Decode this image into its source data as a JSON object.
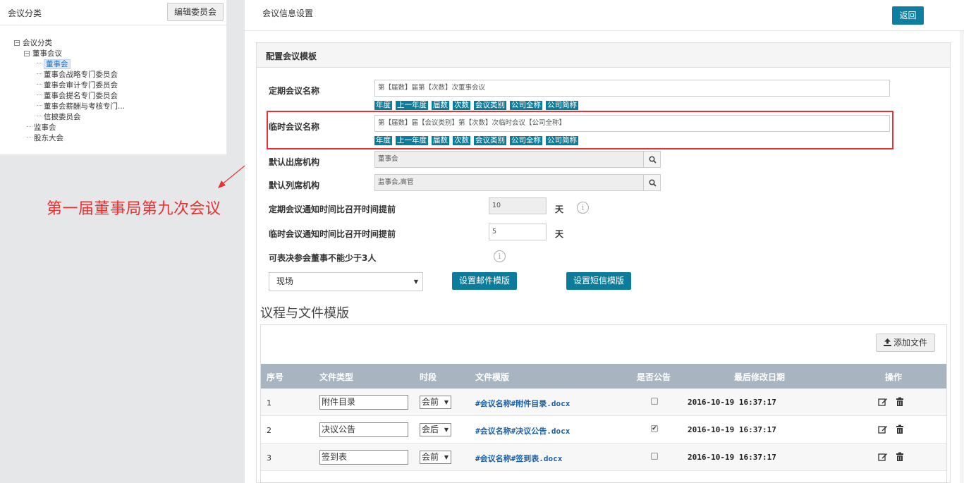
{
  "sidebar": {
    "title": "会议分类",
    "edit_button": "编辑委员会",
    "tree": {
      "root": "会议分类",
      "board": "董事会议",
      "board_children": [
        "董事会",
        "董事会战略专门委员会",
        "董事会审计专门委员会",
        "董事会提名专门委员会",
        "董事会薪酬与考核专门...",
        "信披委员会"
      ],
      "others": [
        "监事会",
        "股东大会"
      ]
    }
  },
  "annotation": {
    "text": "第一届董事局第九次会议",
    "color": "#e63232"
  },
  "header": {
    "title": "会议信息设置",
    "back_button": "返回"
  },
  "config": {
    "panel_title": "配置会议模板",
    "regular_name_label": "定期会议名称",
    "regular_name_value": "第【届数】届第【次数】次董事会议",
    "tags": [
      "年度",
      "上一年度",
      "届数",
      "次数",
      "会议类别",
      "公司全称",
      "公司简称"
    ],
    "temp_name_label": "临时会议名称",
    "temp_name_value": "第【届数】届【会议类别】第【次数】次临时会议【公司全称】",
    "attend_org_label": "默认出席机构",
    "attend_org_value": "董事会",
    "observer_org_label": "默认列席机构",
    "observer_org_value": "监事会,高管",
    "regular_notice_label": "定期会议通知时间比召开时间提前",
    "regular_notice_value": "10",
    "temp_notice_label": "临时会议通知时间比召开时间提前",
    "temp_notice_value": "5",
    "day_unit": "天",
    "quorum_label": "可表决参会董事不能少于3人",
    "mode_select": "现场",
    "email_template_button": "设置邮件模版",
    "sms_template_button": "设置短信模版"
  },
  "agenda": {
    "section_title": "议程与文件模版",
    "add_file_button": "添加文件",
    "columns": [
      "序号",
      "文件类型",
      "时段",
      "文件模版",
      "是否公告",
      "最后修改日期",
      "操作"
    ],
    "rows": [
      {
        "no": "1",
        "type": "附件目录",
        "period": "会前",
        "template": "#会议名称#附件目录.docx",
        "announce": false,
        "date": "2016-10-19 16:37:17"
      },
      {
        "no": "2",
        "type": "决议公告",
        "period": "会后",
        "template": "#会议名称#决议公告.docx",
        "announce": true,
        "date": "2016-10-19 16:37:17"
      },
      {
        "no": "3",
        "type": "签到表",
        "period": "会前",
        "template": "#会议名称#签到表.docx",
        "announce": false,
        "date": "2016-10-19 16:37:17"
      }
    ]
  },
  "colors": {
    "accent": "#0b7c9b",
    "table_header": "#a8b4bf",
    "highlight_box": "#e63232"
  }
}
